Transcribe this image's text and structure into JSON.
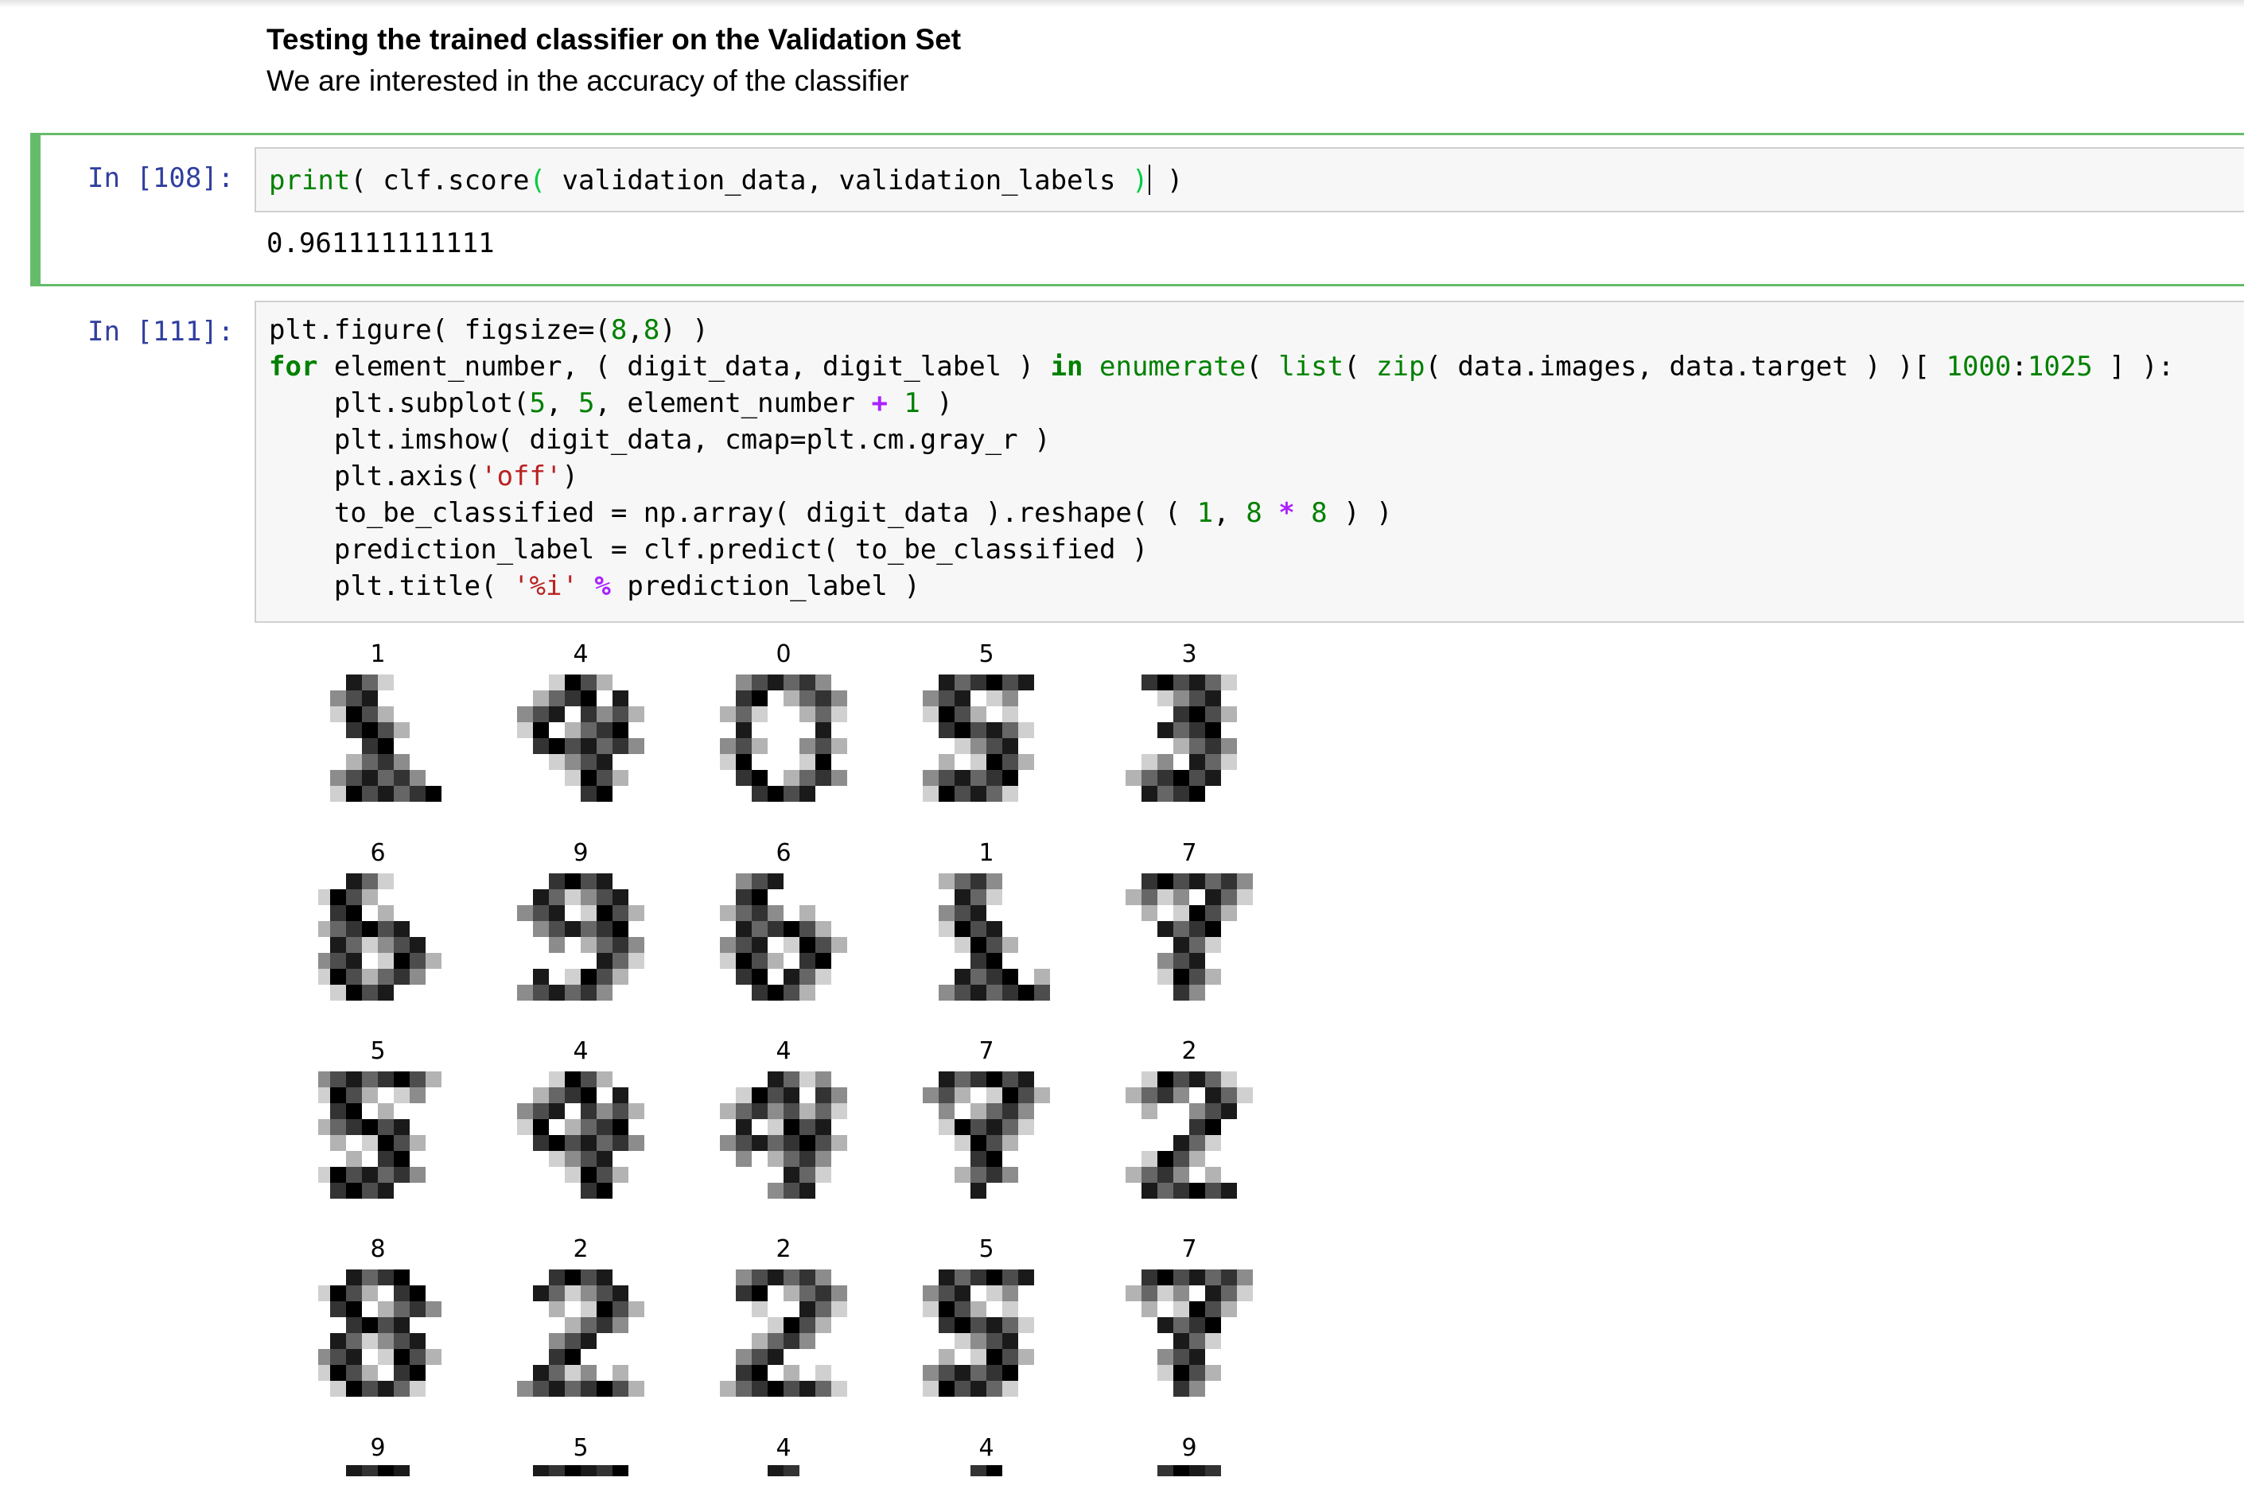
{
  "markdown": {
    "title": "Testing the trained classifier on the Validation Set",
    "text": "We are interested in the accuracy of the classifier"
  },
  "cells": [
    {
      "prompt": "In [108]:",
      "code_lines": [
        "print( clf.score( validation_data, validation_labels ) )"
      ],
      "output": "0.961111111111"
    },
    {
      "prompt": "In [111]:",
      "code_lines": [
        "plt.figure( figsize=(8,8) )",
        "for element_number, ( digit_data, digit_label ) in enumerate( list( zip( data.images, data.target ) )[ 1000:1025 ] ):",
        "    plt.subplot(5, 5, element_number + 1 )",
        "    plt.imshow( digit_data, cmap=plt.cm.gray_r )",
        "    plt.axis('off')",
        "    to_be_classified = np.array( digit_data ).reshape( ( 1, 8 * 8 ) )",
        "    prediction_label = clf.predict( to_be_classified )",
        "    plt.title( '%i' % prediction_label )"
      ]
    }
  ],
  "figure": {
    "predicted_labels": [
      "1",
      "4",
      "0",
      "5",
      "3",
      "6",
      "9",
      "6",
      "1",
      "7",
      "5",
      "4",
      "4",
      "7",
      "2",
      "8",
      "2",
      "2",
      "5",
      "7",
      "9",
      "5",
      "4",
      "4",
      "9"
    ],
    "colormap": "gray_r",
    "axis": "off"
  }
}
